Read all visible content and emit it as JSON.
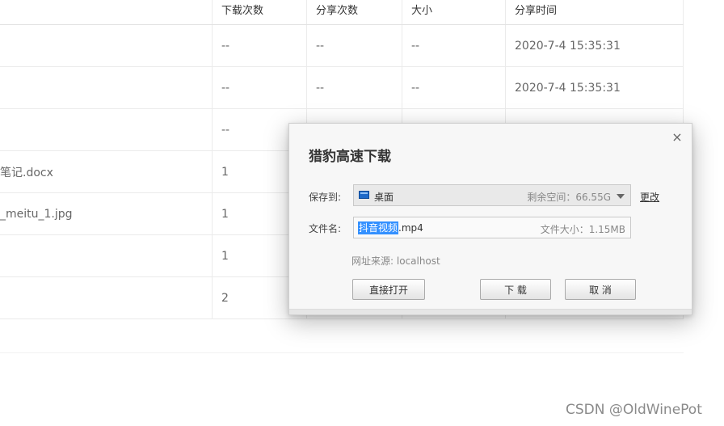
{
  "table": {
    "headers": [
      "下载次数",
      "分享次数",
      "大小",
      "分享时间"
    ],
    "rows": [
      {
        "name": "",
        "downloads": "--",
        "shares": "--",
        "size": "--",
        "time": "2020-7-4 15:35:31"
      },
      {
        "name": "",
        "downloads": "--",
        "shares": "--",
        "size": "--",
        "time": "2020-7-4 15:35:31"
      },
      {
        "name": "",
        "downloads": "--",
        "shares": "",
        "size": "",
        "time": ""
      },
      {
        "name": "笔记.docx",
        "downloads": "1",
        "shares": "",
        "size": "",
        "time": ""
      },
      {
        "name": "_meitu_1.jpg",
        "downloads": "1",
        "shares": "",
        "size": "",
        "time": ""
      },
      {
        "name": "",
        "downloads": "1",
        "shares": "",
        "size": "",
        "time": ""
      },
      {
        "name": "",
        "downloads": "2",
        "shares": "",
        "size": "",
        "time": ""
      }
    ]
  },
  "dialog": {
    "title": "猎豹高速下载",
    "close_glyph": "×",
    "save_label": "保存到:",
    "save_path": "桌面",
    "free_space": "剩余空间：66.55G",
    "change_link": "更改",
    "name_label": "文件名:",
    "file_name_selected": "抖音视频",
    "file_name_ext": ".mp4",
    "file_size": "文件大小：1.15MB",
    "source": "网址来源: localhost",
    "btn_open": "直接打开",
    "btn_download": "下 载",
    "btn_cancel": "取 消",
    "icons": {
      "folder": "desktop-folder-icon",
      "dropdown": "chevron-down-icon",
      "close": "close-icon"
    }
  },
  "watermark": "CSDN @OldWinePot",
  "colors": {
    "selection": "#3390ff",
    "folder": "#1e6ac9"
  }
}
